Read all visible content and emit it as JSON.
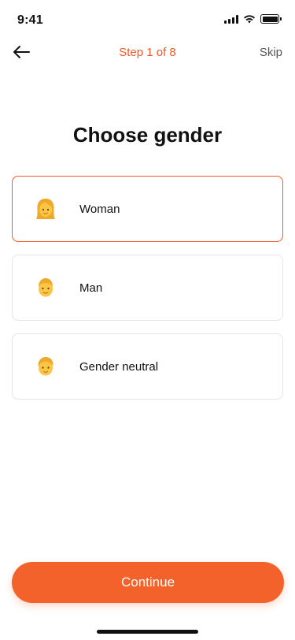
{
  "status_bar": {
    "time": "9:41",
    "signal_icon": "cellular-signal-icon",
    "wifi_icon": "wifi-icon",
    "battery_icon": "battery-icon"
  },
  "nav": {
    "back_icon": "arrow-left-icon",
    "step_label": "Step 1 of 8",
    "skip_label": "Skip"
  },
  "title": "Choose gender",
  "options": [
    {
      "label": "Woman",
      "icon": "woman-emoji-icon",
      "selected": true
    },
    {
      "label": "Man",
      "icon": "man-emoji-icon",
      "selected": false
    },
    {
      "label": "Gender neutral",
      "icon": "person-emoji-icon",
      "selected": false
    }
  ],
  "continue_label": "Continue",
  "colors": {
    "accent": "#F05A28",
    "button": "#F4622C",
    "border": "#E5E5E5"
  }
}
